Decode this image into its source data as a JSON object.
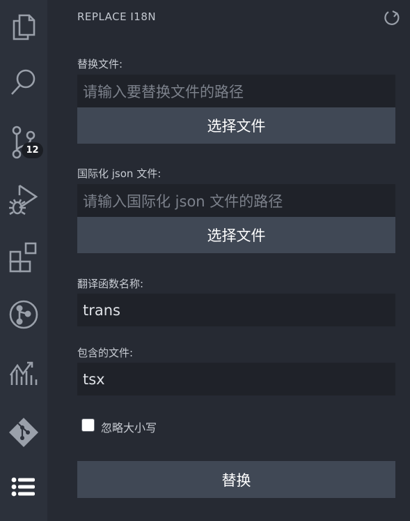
{
  "activity_bar": {
    "icons": [
      "explorer-icon",
      "search-icon",
      "source-control-icon",
      "run-debug-icon",
      "extensions-icon",
      "git-graph-icon",
      "chart-icon",
      "git-icon",
      "list-icon"
    ],
    "source_control_badge": "12"
  },
  "panel": {
    "title": "REPLACE I18N"
  },
  "form": {
    "replace_file": {
      "label": "替换文件:",
      "placeholder": "请输入要替换文件的路径",
      "button": "选择文件"
    },
    "i18n_json": {
      "label": "国际化 json 文件:",
      "placeholder": "请输入国际化 json 文件的路径",
      "button": "选择文件"
    },
    "translate_fn": {
      "label": "翻译函数名称:",
      "value": "trans"
    },
    "include_files": {
      "label": "包含的文件:",
      "value": "tsx"
    },
    "ignore_case": {
      "label": "忽略大小写",
      "checked": false
    },
    "submit_button": "替换"
  },
  "colors": {
    "background": "#262a33",
    "activity_bar": "#2c313b",
    "input_bg": "#1f2229",
    "button_bg": "#404855",
    "icon": "#9aa0aa"
  }
}
